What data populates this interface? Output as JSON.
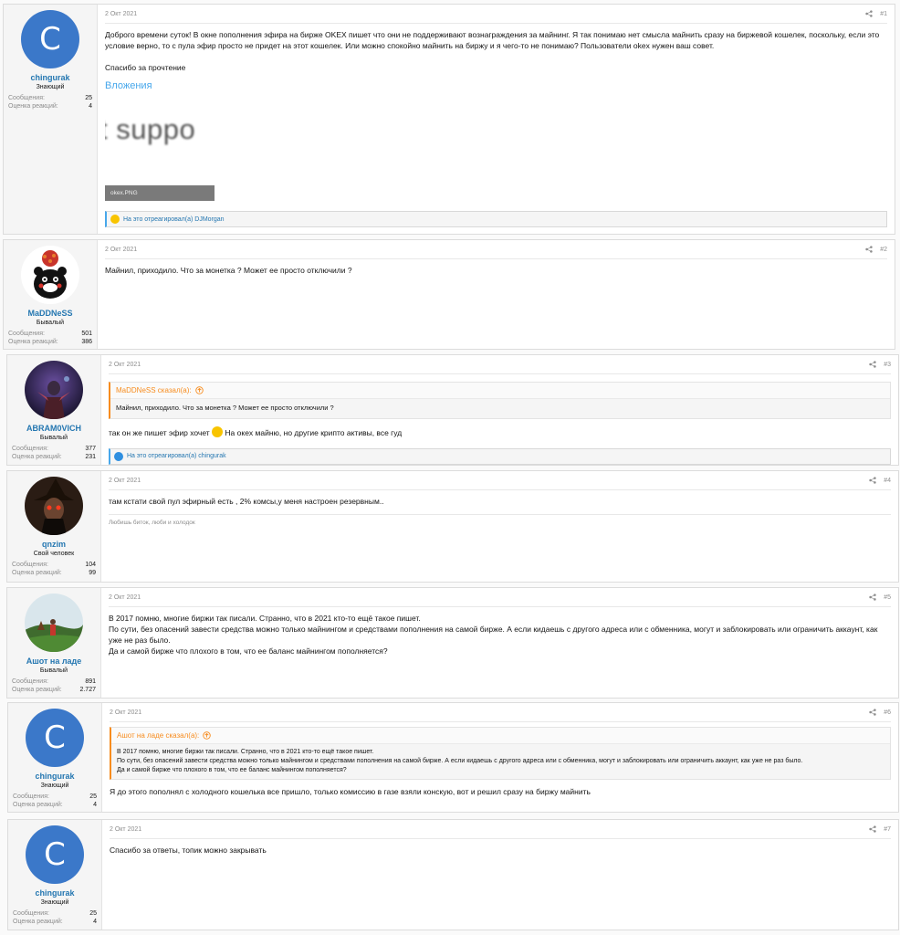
{
  "posts": [
    {
      "author": "chingurak",
      "avatar_letter": "C",
      "title": "Знающий",
      "stats": [
        {
          "label": "Сообщения:",
          "value": "25"
        },
        {
          "label": "Оценка реакций:",
          "value": "4"
        }
      ],
      "date": "2 Окт 2021",
      "number": "#1",
      "text": "Доброго времени суток! В окне пополнения эфира на бирже OKEX пишет что они не поддерживают вознаграждения за майнинг. Я так понимаю нет смысла майнить сразу на биржевой кошелек, поскольку, если это условие верно, то с пула эфир просто не придет на этот кошелек. Или можно спокойно майнить на биржу и я чего-то не понимаю? Пользователи okex нужен ваш совет.",
      "text2": "Спасибо за прочтение",
      "attachments_title": "Вложения",
      "attachment_preview_text": "t suppo",
      "attachment_name": "okex.PNG",
      "reaction": "На это отреагировал(а) DJMorgan"
    },
    {
      "author": "MaDDNeSS",
      "title": "Бывалый",
      "stats": [
        {
          "label": "Сообщения:",
          "value": "501"
        },
        {
          "label": "Оценка реакций:",
          "value": "386"
        }
      ],
      "date": "2 Окт 2021",
      "number": "#2",
      "text": "Майнил, приходило. Что за монетка ? Может ее просто отключили ?"
    },
    {
      "author": "ABRAM0VICH",
      "title": "Бывалый",
      "stats": [
        {
          "label": "Сообщения:",
          "value": "377"
        },
        {
          "label": "Оценка реакций:",
          "value": "231"
        }
      ],
      "date": "2 Окт 2021",
      "number": "#3",
      "quote_author": "MaDDNeSS сказал(а):",
      "quote_text": "Майнил, приходило. Что за монетка ? Может ее просто отключили ?",
      "text_before_emoji": "так он же пишет эфир хочет",
      "text_after_emoji": "На океx майню, но другие крипто активы, все гуд",
      "reaction": "На это отреагировал(а) chingurak"
    },
    {
      "author": "qnzim",
      "title": "Свой человек",
      "stats": [
        {
          "label": "Сообщения:",
          "value": "104"
        },
        {
          "label": "Оценка реакций:",
          "value": "99"
        }
      ],
      "date": "2 Окт 2021",
      "number": "#4",
      "text": "там кстати свой пул эфирный есть , 2% комсы,у меня настроен резервным..",
      "signature": "Любишь биток, люби и холодок"
    },
    {
      "author": "Ашот на ладе",
      "title": "Бывалый",
      "stats": [
        {
          "label": "Сообщения:",
          "value": "891"
        },
        {
          "label": "Оценка реакций:",
          "value": "2.727"
        }
      ],
      "date": "2 Окт 2021",
      "number": "#5",
      "lines": [
        "В 2017 помню, многие биржи так писали. Странно, что в 2021 кто-то ещё такое пишет.",
        "По сути, без опасений завести средства можно только майнингом и средствами пополнения на самой бирже. А если кидаешь с другого адреса или с обменника, могут и заблокировать или ограничить аккаунт, как уже не раз было.",
        "Да и самой бирже что плохого в том, что ее баланс майнингом пополняется?"
      ]
    },
    {
      "author": "chingurak",
      "avatar_letter": "C",
      "title": "Знающий",
      "stats": [
        {
          "label": "Сообщения:",
          "value": "25"
        },
        {
          "label": "Оценка реакций:",
          "value": "4"
        }
      ],
      "date": "2 Окт 2021",
      "number": "#6",
      "quote_author": "Ашот на ладе сказал(а):",
      "quote_lines": [
        "В 2017 помню, многие биржи так писали. Странно, что в 2021 кто-то ещё такое пишет.",
        "По сути, без опасений завести средства можно только майнингом и средствами пополнения на самой бирже. А если кидаешь с другого адреса или с обменника, могут и заблокировать или ограничить аккаунт, как уже не раз было.",
        "Да и самой бирже что плохого в том, что ее баланс майнингом пополняется?"
      ],
      "text": "Я до этого пополнял с холодного кошелька все пришло, только комиссию в газе взяли конскую, вот и решил сразу на биржу майнить"
    },
    {
      "author": "chingurak",
      "avatar_letter": "C",
      "title": "Знающий",
      "stats": [
        {
          "label": "Сообщения:",
          "value": "25"
        },
        {
          "label": "Оценка реакций:",
          "value": "4"
        }
      ],
      "date": "2 Окт 2021",
      "number": "#7",
      "text": "Спасибо за ответы, топик можно закрывать"
    }
  ],
  "colors": {
    "link": "#2577b1",
    "accent_blue": "#47a7eb",
    "quote_orange": "#f78c1e",
    "avatar_blue": "#3b78c9"
  }
}
